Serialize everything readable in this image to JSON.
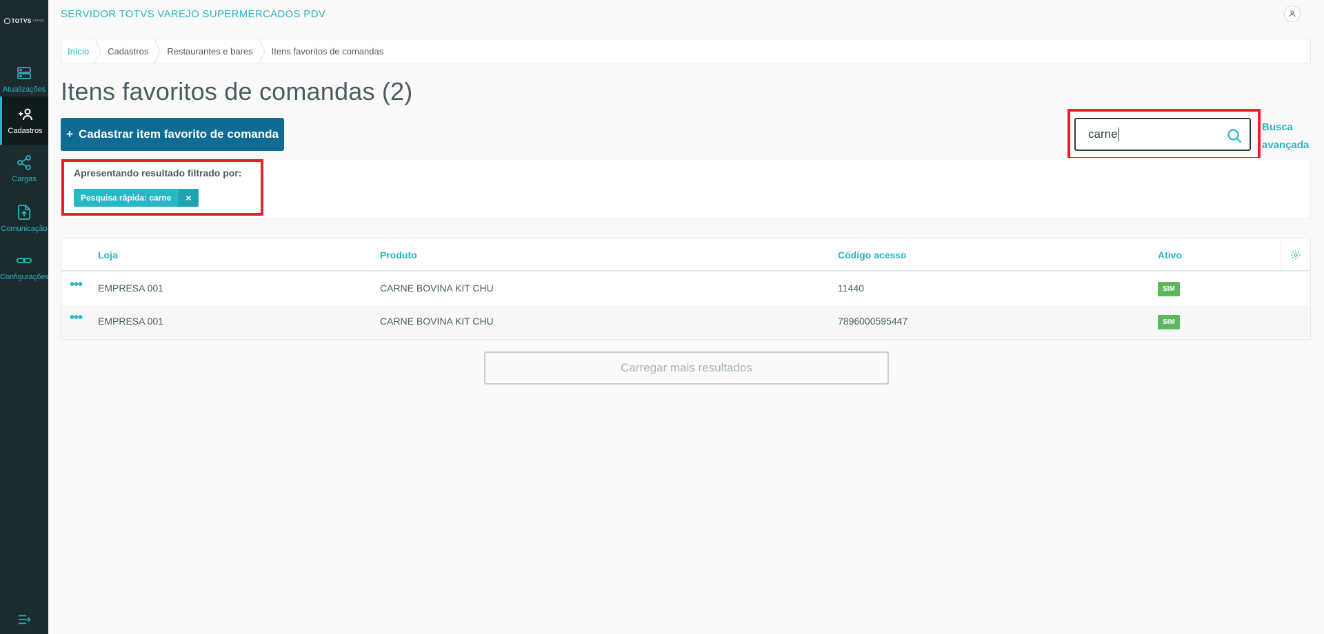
{
  "app": {
    "title": "SERVIDOR TOTVS VAREJO SUPERMERCADOS PDV",
    "logo_text": "TOTVS",
    "logo_sub": "varejo"
  },
  "sidebar": {
    "items": [
      {
        "label": "Atualizações",
        "icon": "server-icon"
      },
      {
        "label": "Cadastros",
        "icon": "add-user-icon"
      },
      {
        "label": "Cargas",
        "icon": "share-nodes-icon"
      },
      {
        "label": "Comunicação",
        "icon": "upload-file-icon"
      },
      {
        "label": "Configurações",
        "icon": "link-icon"
      }
    ],
    "active": "Cadastros"
  },
  "breadcrumb": [
    "Início",
    "Cadastros",
    "Restaurantes e bares",
    "Itens favoritos de comandas"
  ],
  "page": {
    "title": "Itens favoritos de comandas (2)",
    "primary_button": "Cadastrar item favorito de comanda",
    "primary_button_icon": "+"
  },
  "search": {
    "value": "carne",
    "advanced_line1": "Busca",
    "advanced_line2": "avançada"
  },
  "filter": {
    "label": "Apresentando resultado filtrado por:",
    "chip": "Pesquisa rápida: carne",
    "chip_close": "×"
  },
  "table": {
    "columns": [
      "Loja",
      "Produto",
      "Código acesso",
      "Ativo"
    ],
    "rows": [
      {
        "loja": "EMPRESA 001",
        "produto": "CARNE BOVINA KIT CHU",
        "codigo": "11440",
        "ativo": "SIM"
      },
      {
        "loja": "EMPRESA 001",
        "produto": "CARNE BOVINA KIT CHU",
        "codigo": "7896000595447",
        "ativo": "SIM"
      }
    ],
    "row_actions": "•••"
  },
  "load_more": "Carregar mais resultados",
  "colors": {
    "accent": "#29b6c5",
    "primary": "#0c6c94",
    "sidebar": "#1c2b2e",
    "highlight": "#e8202a",
    "badge_active": "#5cb85c"
  }
}
